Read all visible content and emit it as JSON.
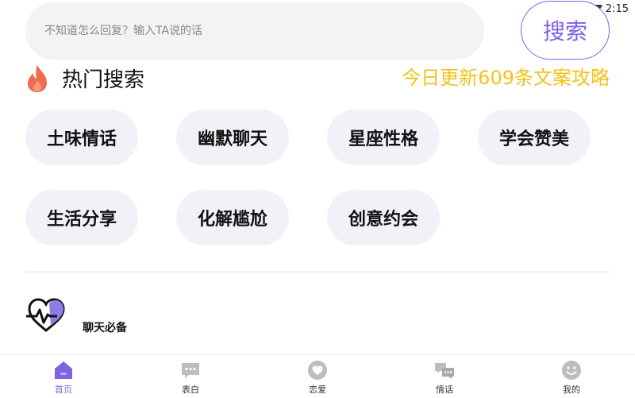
{
  "status": {
    "time": "2:15"
  },
  "search": {
    "placeholder": "不知道怎么回复？输入TA说的话",
    "button_label": "搜索"
  },
  "hot": {
    "title": "热门搜索",
    "update_text": "今日更新609条文案攻略",
    "tags": [
      "土味情话",
      "幽默聊天",
      "星座性格",
      "学会赞美",
      "生活分享",
      "化解尴尬",
      "创意约会"
    ]
  },
  "section": {
    "title": "聊天必备"
  },
  "nav": {
    "items": [
      {
        "label": "首页",
        "icon": "home-icon"
      },
      {
        "label": "表白",
        "icon": "chat-bubble-icon"
      },
      {
        "label": "恋爱",
        "icon": "heart-icon"
      },
      {
        "label": "情话",
        "icon": "chat-bubbles-icon"
      },
      {
        "label": "我的",
        "icon": "smiley-icon"
      }
    ],
    "active_color": "#7f62e4",
    "inactive_color": "#bdbdbd"
  },
  "colors": {
    "accent": "#7f62e4",
    "highlight": "#f2c21a",
    "flame": "#f26b4f"
  }
}
